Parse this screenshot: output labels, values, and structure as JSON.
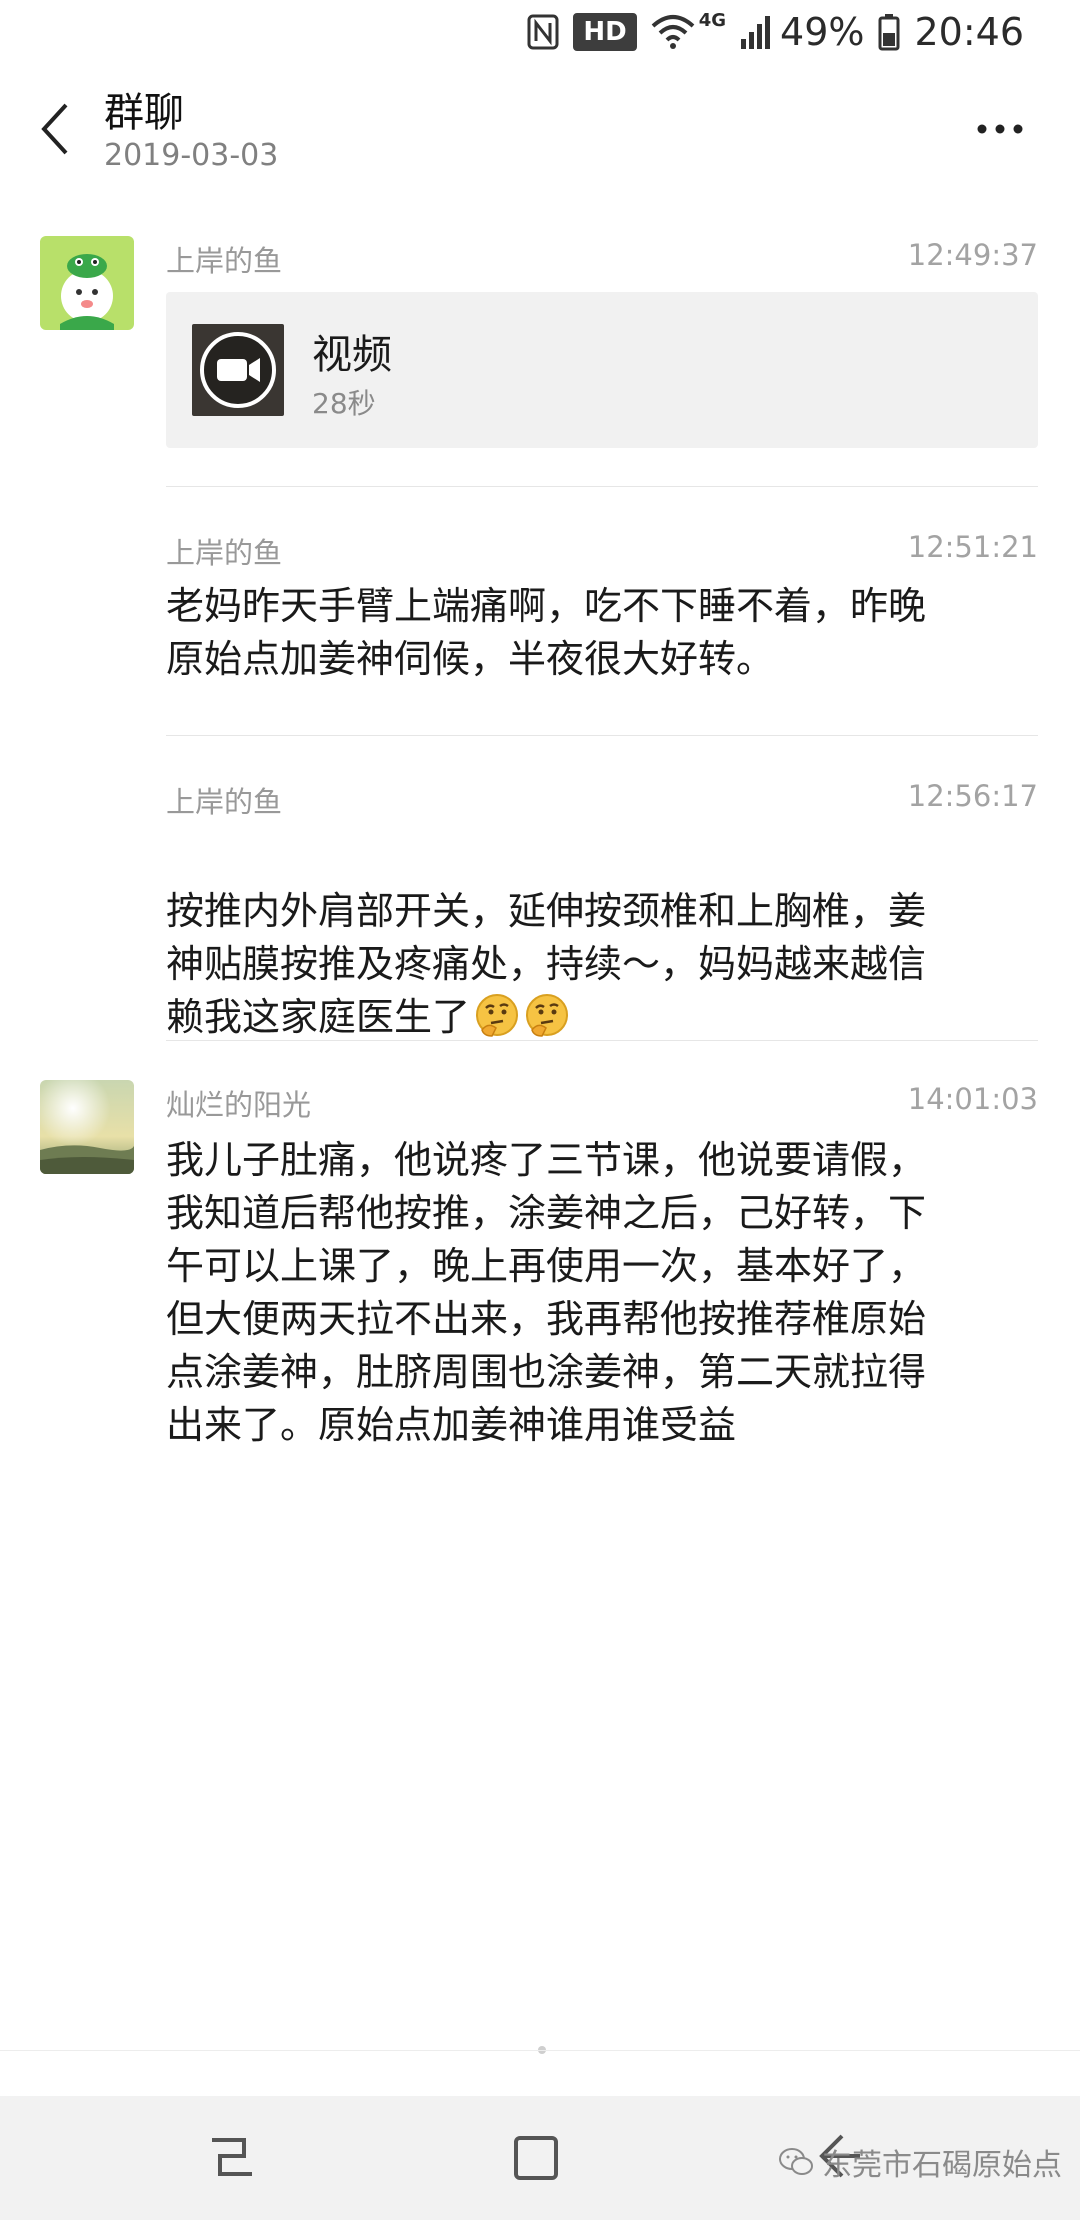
{
  "status_bar": {
    "hd": "HD",
    "network": "4G",
    "battery": "49%",
    "time": "20:46"
  },
  "header": {
    "title": "群聊",
    "date": "2019-03-03"
  },
  "messages": [
    {
      "sender": "上岸的鱼",
      "time": "12:49:37",
      "type": "video",
      "video": {
        "label": "视频",
        "duration": "28秒"
      }
    },
    {
      "sender": "上岸的鱼",
      "time": "12:51:21",
      "type": "text",
      "text": "老妈昨天手臂上端痛啊，吃不下睡不着，昨晚\n原始点加姜神伺候，半夜很大好转。"
    },
    {
      "sender": "上岸的鱼",
      "time": "12:56:17",
      "type": "text",
      "text": "按推内外肩部开关，延伸按颈椎和上胸椎，姜\n神贴膜按推及疼痛处，持续～，妈妈越来越信\n赖我这家庭医生了"
    },
    {
      "sender": "灿烂的阳光",
      "time": "14:01:03",
      "type": "text",
      "text": "我儿子肚痛，他说疼了三节课，他说要请假，\n我知道后帮他按推，涂姜神之后，己好转，下\n午可以上课了，晚上再使用一次，基本好了，\n但大便两天拉不出来，我再帮他按推荐椎原始\n点涂姜神，肚脐周围也涂姜神，第二天就拉得\n出来了。原始点加姜神谁用谁受益"
    }
  ],
  "watermark": "东莞市石碣原始点",
  "icons": {
    "back": "back-arrow-icon",
    "more": "more-dots-icon",
    "video": "video-camera-icon",
    "emoji": "thinking-face-icon"
  }
}
